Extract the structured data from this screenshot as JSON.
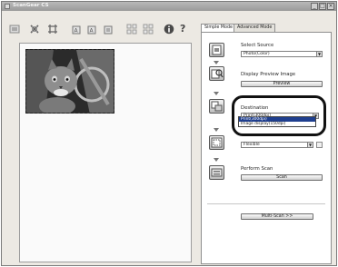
{
  "window": {
    "title": "ScanGear CS"
  },
  "tabs": [
    {
      "label": "Simple Mode"
    },
    {
      "label": "Advanced Mode"
    }
  ],
  "steps": {
    "source": {
      "label": "Select Source",
      "value": "Photo(Color)"
    },
    "preview": {
      "label": "Display Preview Image",
      "button": "Preview"
    },
    "destination": {
      "label": "Destination",
      "value": "Print(300dpi)",
      "options": [
        "Print(300dpi)",
        "Image display(150dpi)"
      ]
    },
    "size": {
      "value": "Flexible"
    },
    "scan": {
      "label": "Perform Scan",
      "button": "Scan"
    }
  },
  "multi_scan_button": "Multi-Scan >>",
  "help_glyph": "?",
  "colors": {
    "highlight_ring": "#111111",
    "selected_option": "#1f3f8f",
    "titlebar": "#a8a8a8"
  },
  "icons": [
    "thumbnail-icon",
    "crop-icon",
    "select-all-icon",
    "rotate-left-icon",
    "rotate-right-icon",
    "mirror-icon",
    "grid-view-icon",
    "grid-view-2-icon",
    "info-icon",
    "help-icon"
  ]
}
